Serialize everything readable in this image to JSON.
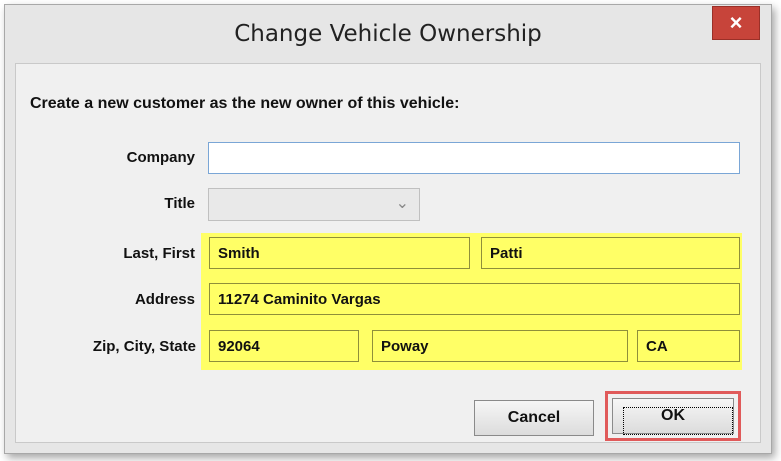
{
  "window": {
    "title": "Change Vehicle Ownership",
    "close_glyph": "×"
  },
  "form": {
    "instruction": "Create a new customer as the new owner of this vehicle:",
    "labels": {
      "company": "Company",
      "title": "Title",
      "last_first": "Last, First",
      "address": "Address",
      "zip_city_state": "Zip, City, State"
    },
    "values": {
      "company": "",
      "title": "",
      "last": "Smith",
      "first": "Patti",
      "address": "11274 Caminito Vargas",
      "zip": "92064",
      "city": "Poway",
      "state": "CA"
    }
  },
  "buttons": {
    "cancel": "Cancel",
    "ok": "OK"
  },
  "icons": {
    "close": "close-icon",
    "dropdown": "chevron-down-icon"
  },
  "colors": {
    "highlight": "#ffff66",
    "close_button": "#c7443a",
    "ok_callout": "#e05a5a"
  }
}
